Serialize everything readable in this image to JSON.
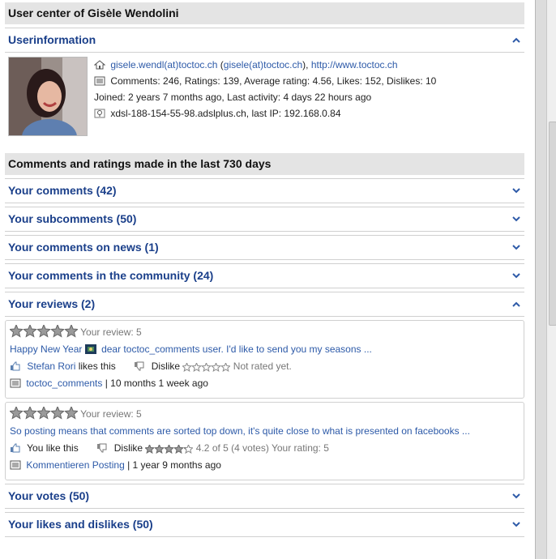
{
  "title": "User center of Gisèle Wendolini",
  "userinfo": {
    "heading": "Userinformation",
    "email1": "gisele.wendl(at)toctoc.ch",
    "email2": "gisele(at)toctoc.ch",
    "website": "http://www.toctoc.ch",
    "stats": "Comments: 246, Ratings: 139, Average rating: 4.56, Likes: 152, Dislikes: 10",
    "joined": "Joined: 2 years 7 months ago, Last activity: 4 days 22 hours ago",
    "host": "xdsl-188-154-55-98.adslplus.ch, last IP: 192.168.0.84",
    "paren_open": "(",
    "paren_close": "),",
    "comma": ","
  },
  "section2": {
    "heading": "Comments and ratings made in the last 730 days",
    "items": [
      {
        "label": "Your comments (42)"
      },
      {
        "label": "Your subcomments (50)"
      },
      {
        "label": "Your comments on news (1)"
      },
      {
        "label": "Your comments in the community (24)"
      }
    ],
    "reviews": {
      "label": "Your reviews (2)",
      "list": [
        {
          "your_review": "Your review: 5",
          "rating": 5,
          "text_a": "Happy New Year",
          "text_b": "dear toctoc_comments user. I'd like to send you my seasons ...",
          "liker": "Stefan Rori",
          "likes_text": "likes this",
          "dislike": "Dislike",
          "not_rated": "Not rated yet.",
          "source": "toctoc_comments",
          "time": "| 10 months 1 week ago"
        },
        {
          "your_review": "Your review: 5",
          "rating": 5,
          "text": "So posting means that comments are sorted top down, it's quite close to what is presented on facebooks ...",
          "like": "You like this",
          "dislike": "Dislike",
          "avg": "4.2 of 5 (4 votes) Your rating: 5",
          "avg_rating": 4.2,
          "source": "Kommentieren Posting",
          "time": "| 1 year 9 months ago"
        }
      ]
    },
    "after": [
      {
        "label": "Your votes (50)"
      },
      {
        "label": "Your likes and dislikes (50)"
      }
    ]
  },
  "colors": {
    "link": "#2d5aa8",
    "heading": "#1a3f8a",
    "header_bg": "#e4e4e4"
  }
}
